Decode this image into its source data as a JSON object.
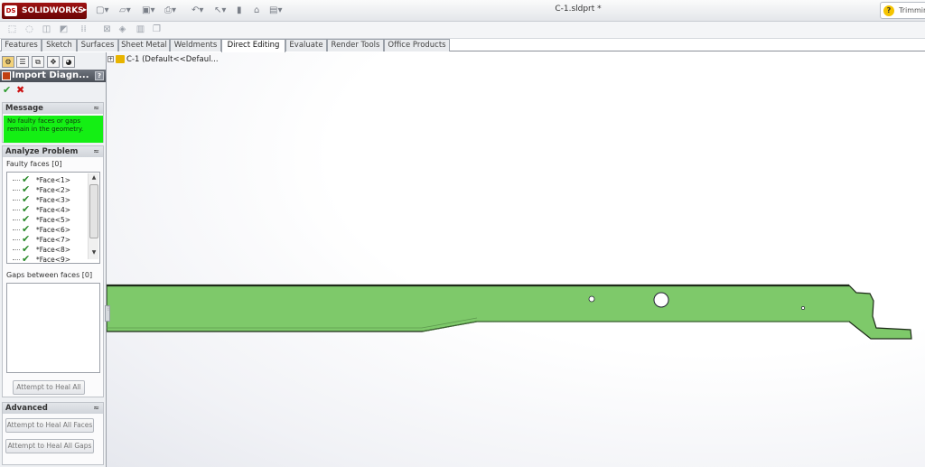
{
  "app": {
    "logo_text": "SOLIDWORKS",
    "logo_badge": "DS",
    "document_title": "C-1.sldprt *",
    "search_text": "Trimmin",
    "search_icon": "?"
  },
  "quick_access": {
    "icons": [
      "new-icon",
      "open-icon",
      "save-icon",
      "print-icon",
      "undo-icon",
      "select-icon",
      "rebuild-icon",
      "file-properties-icon",
      "options-icon"
    ]
  },
  "command_tabs": [
    "Features",
    "Sketch",
    "Surfaces",
    "Sheet Metal",
    "Weldments",
    "Direct Editing",
    "Evaluate",
    "Render Tools",
    "Office Products"
  ],
  "active_tab": "Direct Editing",
  "property_manager": {
    "title": "Import Diagn...",
    "help": "?",
    "ok": "✔",
    "cancel": "✖",
    "message_group": {
      "title": "Message",
      "text": "No faulty faces or gaps remain in the geometry."
    },
    "analyze_group": {
      "title": "Analyze Problem",
      "faulty_label": "Faulty faces [0]",
      "faces": [
        "*Face<1>",
        "*Face<2>",
        "*Face<3>",
        "*Face<4>",
        "*Face<5>",
        "*Face<6>",
        "*Face<7>",
        "*Face<8>",
        "*Face<9>"
      ],
      "gaps_label": "Gaps between faces [0]",
      "heal_all_button": "Attempt to Heal All"
    },
    "advanced_group": {
      "title": "Advanced",
      "heal_faces_button": "Attempt to Heal All Faces",
      "heal_gaps_button": "Attempt to Heal All Gaps"
    }
  },
  "feature_tree": {
    "root_label": "C-1  (Default<<Defaul..."
  },
  "colors": {
    "part_fill": "#7ec96a",
    "part_edge": "#1d2a18",
    "message_bg": "#14ef14",
    "ok_green": "#2a9a2a",
    "cancel_red": "#cc1111"
  }
}
